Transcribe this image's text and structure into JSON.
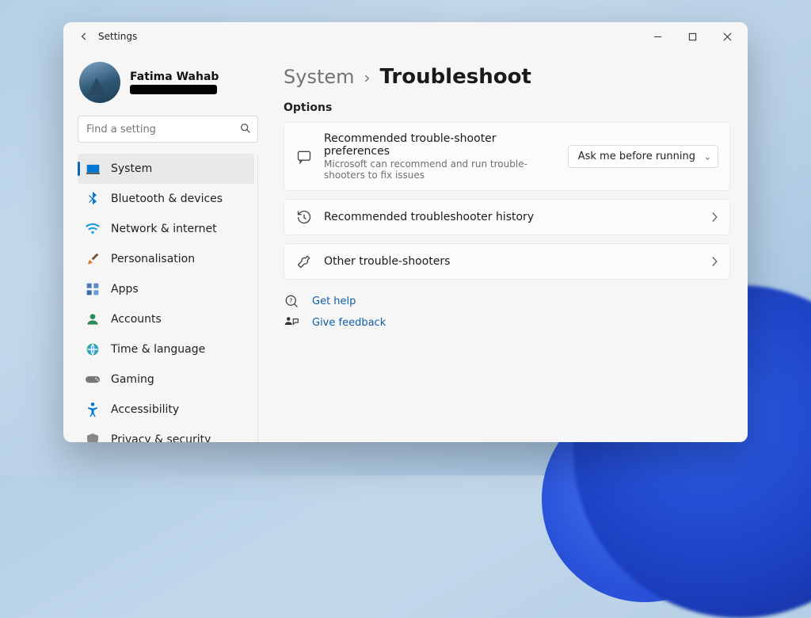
{
  "window": {
    "app_title": "Settings"
  },
  "profile": {
    "name": "Fatima Wahab"
  },
  "search": {
    "placeholder": "Find a setting"
  },
  "nav": {
    "items": [
      {
        "label": "System"
      },
      {
        "label": "Bluetooth & devices"
      },
      {
        "label": "Network & internet"
      },
      {
        "label": "Personalisation"
      },
      {
        "label": "Apps"
      },
      {
        "label": "Accounts"
      },
      {
        "label": "Time & language"
      },
      {
        "label": "Gaming"
      },
      {
        "label": "Accessibility"
      },
      {
        "label": "Privacy & security"
      }
    ],
    "active_index": 0
  },
  "breadcrumb": {
    "parent": "System",
    "current": "Troubleshoot"
  },
  "section": {
    "label": "Options"
  },
  "cards": {
    "prefs": {
      "title": "Recommended trouble-shooter preferences",
      "subtitle": "Microsoft can recommend and run trouble-shooters to fix issues",
      "select_value": "Ask me before running"
    },
    "history": {
      "title": "Recommended troubleshooter history"
    },
    "other": {
      "title": "Other trouble-shooters"
    }
  },
  "links": {
    "help": "Get help",
    "feedback": "Give feedback"
  }
}
